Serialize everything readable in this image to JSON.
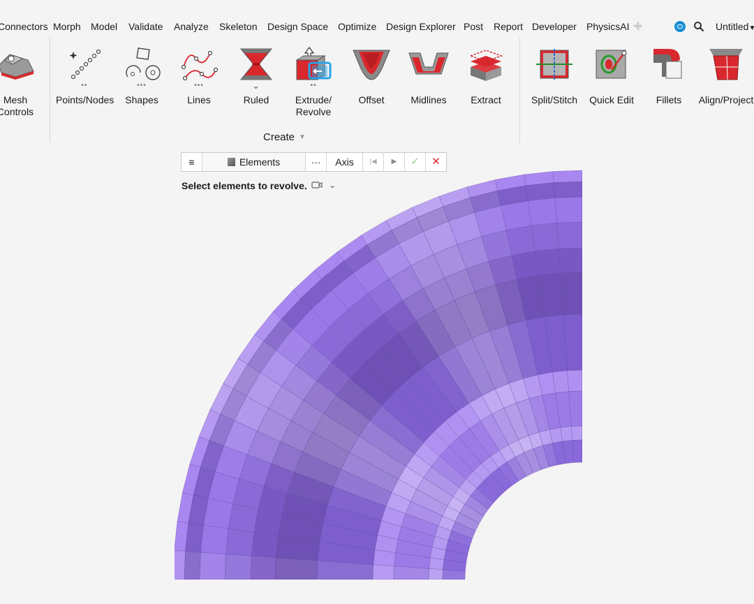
{
  "menu": {
    "items": [
      "Connectors",
      "Morph",
      "Model",
      "Validate",
      "Analyze",
      "Skeleton",
      "Design Space",
      "Optimize",
      "Design Explorer",
      "Post",
      "Report",
      "Developer",
      "PhysicsAI"
    ],
    "file_title": "Untitled"
  },
  "ribbon": {
    "tools": [
      {
        "label": "Mesh\nControls",
        "icon": "mesh-controls-icon"
      },
      {
        "label": "Points/Nodes",
        "icon": "points-nodes-icon",
        "dots": "••"
      },
      {
        "label": "Shapes",
        "icon": "shapes-icon",
        "dots": "•••"
      },
      {
        "label": "Lines",
        "icon": "lines-icon",
        "dots": "•••"
      },
      {
        "label": "Ruled",
        "icon": "ruled-icon",
        "dots": "⌄"
      },
      {
        "label": "Extrude/\nRevolve",
        "icon": "extrude-revolve-icon",
        "dots": "••"
      },
      {
        "label": "Offset",
        "icon": "offset-icon"
      },
      {
        "label": "Midlines",
        "icon": "midlines-icon"
      },
      {
        "label": "Extract",
        "icon": "extract-icon"
      },
      {
        "label": "Split/Stitch",
        "icon": "split-stitch-icon"
      },
      {
        "label": "Quick Edit",
        "icon": "quick-edit-icon"
      },
      {
        "label": "Fillets",
        "icon": "fillets-icon"
      },
      {
        "label": "Align/Project",
        "icon": "align-project-icon"
      }
    ],
    "group_label": "Create"
  },
  "context_toolbar": {
    "entity": "Elements",
    "more": "···",
    "axis": "Axis",
    "hint": "Select elements to revolve."
  },
  "colors": {
    "mesh_light": "#b08cf2",
    "mesh_mid": "#8d68de",
    "mesh_dark": "#6a4fa8",
    "accent_red": "#d8282e",
    "accent_blue": "#1a8fd1"
  }
}
